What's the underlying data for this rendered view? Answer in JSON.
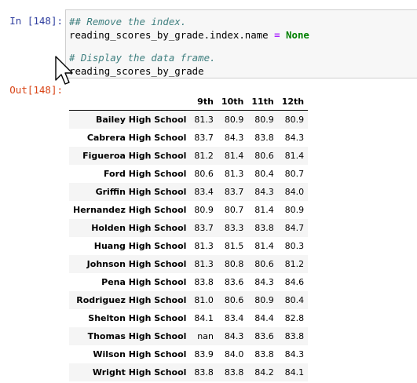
{
  "input_cell": {
    "prompt": "In [148]:",
    "line1_comment": "## Remove the index.",
    "line2_target": "reading_scores_by_grade.index.name ",
    "line2_op": "=",
    "line2_value": "None",
    "line4_comment": "# Display the data frame.",
    "line5_code": "reading_scores_by_grade"
  },
  "output_cell": {
    "prompt": "Out[148]:"
  },
  "table": {
    "columns": [
      "9th",
      "10th",
      "11th",
      "12th"
    ],
    "rows": [
      {
        "name": "Bailey High School",
        "values": [
          "81.3",
          "80.9",
          "80.9",
          "80.9"
        ]
      },
      {
        "name": "Cabrera High School",
        "values": [
          "83.7",
          "84.3",
          "83.8",
          "84.3"
        ]
      },
      {
        "name": "Figueroa High School",
        "values": [
          "81.2",
          "81.4",
          "80.6",
          "81.4"
        ]
      },
      {
        "name": "Ford High School",
        "values": [
          "80.6",
          "81.3",
          "80.4",
          "80.7"
        ]
      },
      {
        "name": "Griffin High School",
        "values": [
          "83.4",
          "83.7",
          "84.3",
          "84.0"
        ]
      },
      {
        "name": "Hernandez High School",
        "values": [
          "80.9",
          "80.7",
          "81.4",
          "80.9"
        ]
      },
      {
        "name": "Holden High School",
        "values": [
          "83.7",
          "83.3",
          "83.8",
          "84.7"
        ]
      },
      {
        "name": "Huang High School",
        "values": [
          "81.3",
          "81.5",
          "81.4",
          "80.3"
        ]
      },
      {
        "name": "Johnson High School",
        "values": [
          "81.3",
          "80.8",
          "80.6",
          "81.2"
        ]
      },
      {
        "name": "Pena High School",
        "values": [
          "83.8",
          "83.6",
          "84.3",
          "84.6"
        ]
      },
      {
        "name": "Rodriguez High School",
        "values": [
          "81.0",
          "80.6",
          "80.9",
          "80.4"
        ]
      },
      {
        "name": "Shelton High School",
        "values": [
          "84.1",
          "83.4",
          "84.4",
          "82.8"
        ]
      },
      {
        "name": "Thomas High School",
        "values": [
          "nan",
          "84.3",
          "83.6",
          "83.8"
        ]
      },
      {
        "name": "Wilson High School",
        "values": [
          "83.9",
          "84.0",
          "83.8",
          "84.3"
        ]
      },
      {
        "name": "Wright High School",
        "values": [
          "83.8",
          "83.8",
          "84.2",
          "84.1"
        ]
      }
    ]
  },
  "cursor_icon": "mouse-pointer-icon"
}
